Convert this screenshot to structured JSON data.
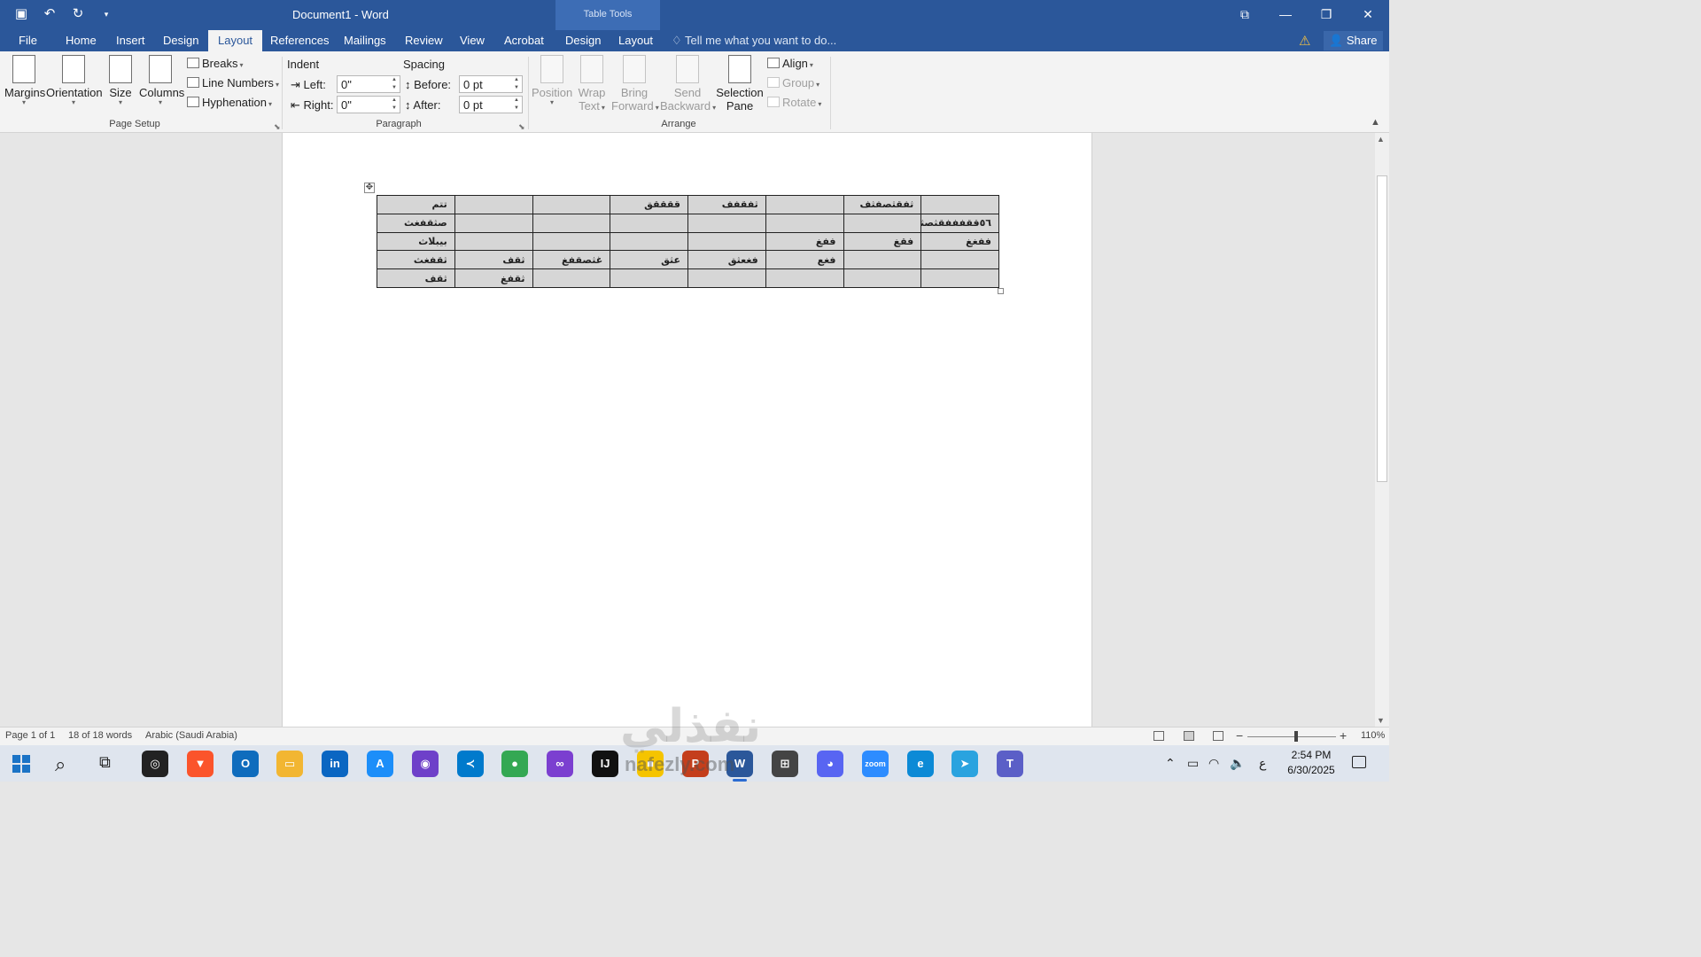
{
  "window": {
    "title": "Document1 - Word",
    "context_label": "Table Tools",
    "warning_icon": "warning-icon",
    "share_label": "Share"
  },
  "tabs": [
    "File",
    "Home",
    "Insert",
    "Design",
    "Layout",
    "References",
    "Mailings",
    "Review",
    "View",
    "Acrobat",
    "Design",
    "Layout"
  ],
  "active_tab": "Layout",
  "tell_me": "Tell me what you want to do...",
  "ribbon": {
    "page_setup": {
      "label": "Page Setup",
      "margins": "Margins",
      "orientation": "Orientation",
      "size": "Size",
      "columns": "Columns",
      "breaks": "Breaks",
      "line_numbers": "Line Numbers",
      "hyphenation": "Hyphenation"
    },
    "paragraph": {
      "label": "Paragraph",
      "indent": "Indent",
      "left_label": "Left:",
      "left_value": "0\"",
      "right_label": "Right:",
      "right_value": "0\"",
      "spacing": "Spacing",
      "before_label": "Before:",
      "before_value": "0 pt",
      "after_label": "After:",
      "after_value": "0 pt"
    },
    "arrange": {
      "label": "Arrange",
      "position": "Position",
      "wrap": "Wrap",
      "text": "Text",
      "bring": "Bring",
      "forward": "Forward",
      "send": "Send",
      "backward": "Backward",
      "selection": "Selection",
      "pane": "Pane",
      "align": "Align",
      "group": "Group",
      "rotate": "Rotate"
    }
  },
  "table": {
    "rows": [
      [
        "تتم",
        "",
        "",
        "ققققق",
        "ثفقفف",
        "",
        "ثفقثصفثف",
        ""
      ],
      [
        "صثقفغث",
        "",
        "",
        "",
        "",
        "",
        "",
        "٥٦ققفففقثصثف"
      ],
      [
        "بيبلاث",
        "",
        "",
        "",
        "",
        "ففغ",
        "فقغ",
        "ففغغ"
      ],
      [
        "ثقفغث",
        "ثقف",
        "غثصقفغ",
        "عثق",
        "فغعثق",
        "فغع",
        "",
        ""
      ],
      [
        "ثقف",
        "ثقفغ",
        "",
        "",
        "",
        "",
        "",
        ""
      ]
    ]
  },
  "status": {
    "page": "Page 1 of 1",
    "words": "18 of 18 words",
    "language": "Arabic (Saudi Arabia)",
    "zoom": "110%",
    "zoom_level": 0.55
  },
  "taskbar": {
    "apps": [
      {
        "name": "chatgpt",
        "glyph": "◎",
        "color": "#222222"
      },
      {
        "name": "brave",
        "glyph": "▼",
        "color": "#fb542b"
      },
      {
        "name": "outlook",
        "glyph": "O",
        "color": "#0f6cbd"
      },
      {
        "name": "file-explorer",
        "glyph": "▭",
        "color": "#f2b632"
      },
      {
        "name": "linkedin",
        "glyph": "in",
        "color": "#0a66c2"
      },
      {
        "name": "app-store",
        "glyph": "A",
        "color": "#1c8ef9"
      },
      {
        "name": "github",
        "glyph": "◉",
        "color": "#6e40c9"
      },
      {
        "name": "vscode",
        "glyph": "≺",
        "color": "#007acc"
      },
      {
        "name": "chrome",
        "glyph": "●",
        "color": "#34a853"
      },
      {
        "name": "visual-studio",
        "glyph": "∞",
        "color": "#7b3fd0"
      },
      {
        "name": "intellij",
        "glyph": "IJ",
        "color": "#111111"
      },
      {
        "name": "sticky-notes",
        "glyph": "■",
        "color": "#f5c400"
      },
      {
        "name": "powerpoint",
        "glyph": "P",
        "color": "#c43e1c"
      },
      {
        "name": "word",
        "glyph": "W",
        "color": "#2b579a"
      },
      {
        "name": "store",
        "glyph": "⊞",
        "color": "#444444"
      },
      {
        "name": "discord",
        "glyph": "◕",
        "color": "#5865f2"
      },
      {
        "name": "zoom",
        "glyph": "zoom",
        "color": "#2d8cff"
      },
      {
        "name": "edge",
        "glyph": "e",
        "color": "#0c8ad6"
      },
      {
        "name": "telegram",
        "glyph": "➤",
        "color": "#2aa3df"
      },
      {
        "name": "teams",
        "glyph": "T",
        "color": "#5b5fc7"
      }
    ],
    "tray_lang": "ع",
    "time": "2:54 PM",
    "date": "6/30/2025"
  },
  "watermark": {
    "arabic": "نفذلي",
    "latin": "nafezly.com"
  }
}
